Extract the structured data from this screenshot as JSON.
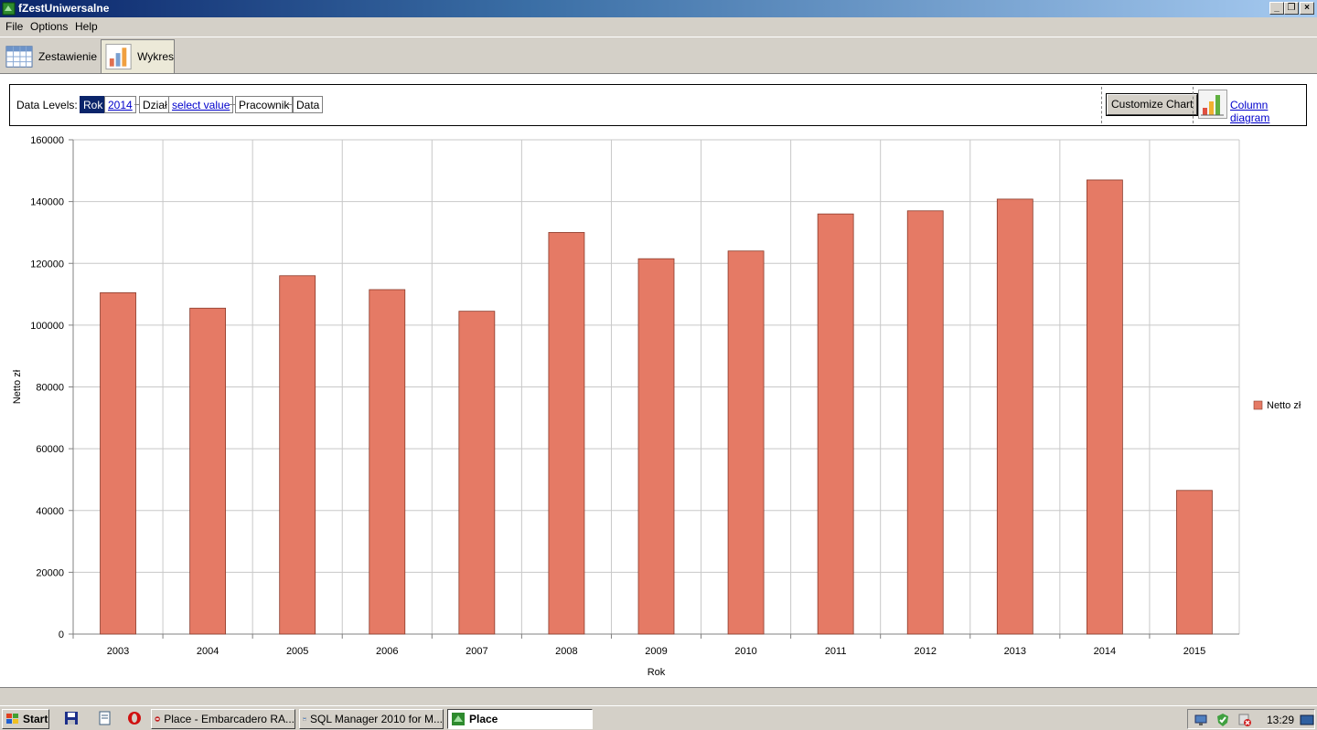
{
  "window": {
    "title": "fZestUniwersalne"
  },
  "menu": [
    "File",
    "Options",
    "Help"
  ],
  "tabs": [
    {
      "label": "Zestawienie",
      "icon": "table-grid-icon",
      "active": false
    },
    {
      "label": "Wykres",
      "icon": "bar-chart-icon",
      "active": true
    }
  ],
  "levels": {
    "label": "Data Levels:",
    "rok": "Rok",
    "rok_value": "2014",
    "dzial": "Dział",
    "dzial_value": "select value",
    "pracownik": "Pracownik",
    "data": "Data",
    "customize": "Customize Chart",
    "diagram": "Column diagram"
  },
  "chart_data": {
    "type": "bar",
    "categories": [
      "2003",
      "2004",
      "2005",
      "2006",
      "2007",
      "2008",
      "2009",
      "2010",
      "2011",
      "2012",
      "2013",
      "2014",
      "2015"
    ],
    "series": [
      {
        "name": "Netto zł",
        "color": "#e57a65",
        "values": [
          110500,
          105500,
          116000,
          111500,
          104500,
          130000,
          121500,
          124000,
          136000,
          137000,
          140800,
          147000,
          46500
        ]
      }
    ],
    "xlabel": "Rok",
    "ylabel": "Netto zł",
    "ylim": [
      0,
      160000
    ],
    "yticks": [
      "0",
      "20000",
      "40000",
      "60000",
      "80000",
      "100000",
      "120000",
      "140000",
      "160000"
    ],
    "grid": true,
    "legend_position": "right"
  },
  "taskbar": {
    "start": "Start",
    "items": [
      {
        "label": "Place - Embarcadero RA...",
        "icon": "embarcadero-icon"
      },
      {
        "label": "SQL Manager 2010 for M...",
        "icon": "sql-manager-icon"
      },
      {
        "label": "Place",
        "icon": "app-icon",
        "active": true
      }
    ],
    "clock": "13:29"
  }
}
